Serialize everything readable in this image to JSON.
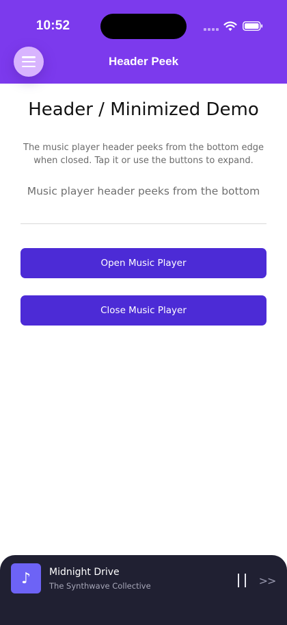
{
  "status_bar": {
    "time": "10:52"
  },
  "header": {
    "title": "Header Peek",
    "menu_icon": "hamburger-menu-icon",
    "background": "#7c3aed"
  },
  "main": {
    "title": "Header / Minimized Demo",
    "description": "The music player header peeks from the bottom edge when closed. Tap it or use the buttons to expand.",
    "subtext": "Music player header peeks from the bottom",
    "buttons": {
      "open_label": "Open Music Player",
      "close_label": "Close Music Player",
      "color": "#4c2bd6"
    }
  },
  "player": {
    "track_title": "Midnight Drive",
    "artist": "The Synthwave Collective",
    "album_icon": "music-note-icon",
    "album_icon_glyph": "♪",
    "pause_icon": "pause-icon",
    "next_icon": "next-icon",
    "next_glyph": ">>",
    "background": "#202032"
  }
}
